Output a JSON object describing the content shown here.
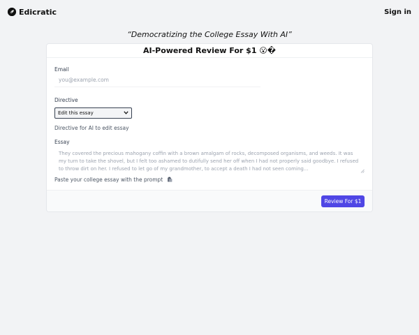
{
  "nav": {
    "brand": "Edicratic",
    "signin": "Sign in"
  },
  "tagline": "“Democratizing the College Essay With AI”",
  "card": {
    "title": "AI-Powered Review For $1 😮​�",
    "email": {
      "label": "Email",
      "placeholder": "you@example.com",
      "value": ""
    },
    "directive": {
      "label": "Directive",
      "selected": "Edit this essay",
      "helper": "Directive for AI to edit essay"
    },
    "essay": {
      "label": "Essay",
      "placeholder": "They covered the precious mahogany coffin with a brown amalgam of rocks, decomposed organisms, and weeds. It was my turn to take the shovel, but I felt too ashamed to dutifully send her off when I had not properly said goodbye. I refused to throw dirt on her. I refused to let go of my grandmother, to accept a death I had not seen coming...",
      "helper": "Paste your college essay with the prompt"
    },
    "submit_label": "Review For $1"
  },
  "colors": {
    "accent": "#4f46e5",
    "background": "#f2f3f5"
  }
}
